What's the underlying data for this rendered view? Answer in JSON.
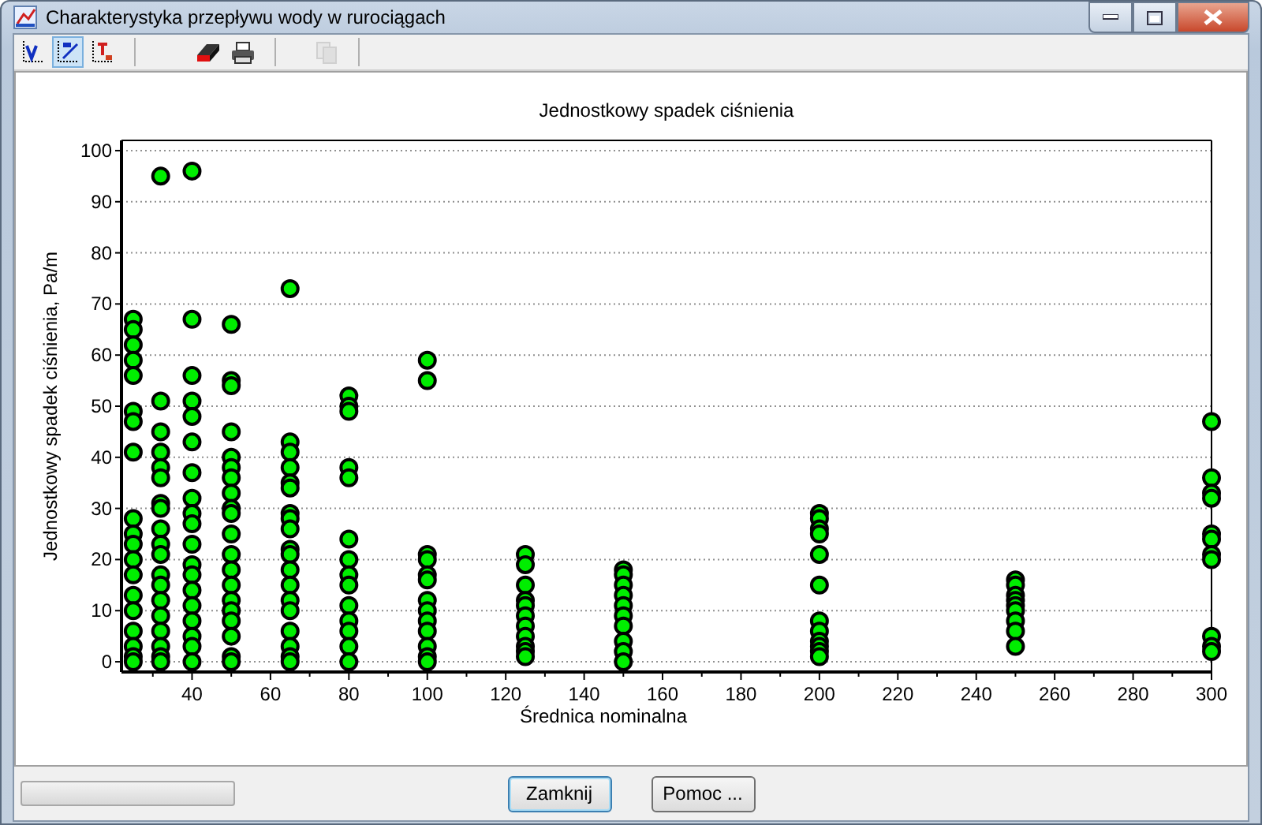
{
  "window": {
    "title": "Charakterystyka przepływu wody w rurociągach"
  },
  "toolbar": [
    {
      "kind": "chart-v",
      "selected": false,
      "disabled": false
    },
    {
      "kind": "chart-dp",
      "selected": true,
      "disabled": false
    },
    {
      "kind": "chart-t",
      "selected": false,
      "disabled": false
    },
    {
      "kind": "eraser",
      "selected": false,
      "disabled": false
    },
    {
      "kind": "printer",
      "selected": false,
      "disabled": false
    },
    {
      "kind": "copy",
      "selected": false,
      "disabled": true
    }
  ],
  "chart": {
    "chart_data": {
      "type": "scatter",
      "title": "Jednostkowy spadek ciśnienia",
      "xlabel": "Średnica nominalna",
      "ylabel": "Jednostkowy spadek ciśnienia, Pa/m",
      "xlim": [
        22,
        300
      ],
      "ylim": [
        -2,
        102
      ],
      "xticks": [
        40,
        60,
        80,
        100,
        120,
        140,
        160,
        180,
        200,
        220,
        240,
        260,
        280,
        300
      ],
      "yticks": [
        0,
        10,
        20,
        30,
        40,
        50,
        60,
        70,
        80,
        90,
        100
      ],
      "x": [
        25,
        25,
        25,
        25,
        25,
        25,
        25,
        25,
        25,
        25,
        25,
        25,
        25,
        25,
        25,
        25,
        25,
        25,
        25,
        32,
        32,
        32,
        32,
        32,
        32,
        32,
        32,
        32,
        32,
        32,
        32,
        32,
        32,
        32,
        32,
        32,
        32,
        32,
        40,
        40,
        40,
        40,
        40,
        40,
        40,
        40,
        40,
        40,
        40,
        40,
        40,
        40,
        40,
        40,
        40,
        40,
        40,
        50,
        50,
        50,
        50,
        50,
        50,
        50,
        50,
        50,
        50,
        50,
        50,
        50,
        50,
        50,
        50,
        50,
        50,
        50,
        50,
        65,
        65,
        65,
        65,
        65,
        65,
        65,
        65,
        65,
        65,
        65,
        65,
        65,
        65,
        65,
        65,
        65,
        65,
        65,
        80,
        80,
        80,
        80,
        80,
        80,
        80,
        80,
        80,
        80,
        80,
        80,
        80,
        80,
        100,
        100,
        100,
        100,
        100,
        100,
        100,
        100,
        100,
        100,
        100,
        100,
        100,
        125,
        125,
        125,
        125,
        125,
        125,
        125,
        125,
        125,
        125,
        125,
        150,
        150,
        150,
        150,
        150,
        150,
        150,
        150,
        150,
        150,
        200,
        200,
        200,
        200,
        200,
        200,
        200,
        200,
        200,
        200,
        200,
        200,
        250,
        250,
        250,
        250,
        250,
        250,
        250,
        250,
        250,
        300,
        300,
        300,
        300,
        300,
        300,
        300,
        300,
        300,
        300,
        300
      ],
      "grid": true,
      "series": [
        {
          "color": "#00ee00",
          "values": [
            67,
            65,
            62,
            59,
            56,
            49,
            47,
            41,
            28,
            25,
            23,
            20,
            17,
            13,
            10,
            6,
            3,
            1,
            0,
            95,
            51,
            45,
            41,
            38,
            36,
            31,
            30,
            26,
            23,
            21,
            17,
            15,
            12,
            9,
            6,
            3,
            1,
            0,
            96,
            67,
            56,
            51,
            48,
            43,
            37,
            32,
            29,
            27,
            23,
            19,
            17,
            14,
            11,
            8,
            5,
            3,
            0,
            66,
            55,
            54,
            45,
            40,
            38,
            36,
            33,
            30,
            29,
            25,
            21,
            18,
            15,
            12,
            10,
            8,
            5,
            1,
            0,
            73,
            43,
            41,
            38,
            35,
            34,
            29,
            28,
            26,
            22,
            21,
            18,
            15,
            12,
            10,
            6,
            3,
            1,
            0,
            52,
            50,
            49,
            38,
            36,
            24,
            20,
            17,
            15,
            11,
            8,
            6,
            3,
            0,
            59,
            55,
            21,
            20,
            17,
            16,
            12,
            10,
            8,
            6,
            3,
            1,
            0,
            21,
            19,
            15,
            12,
            11,
            9,
            7,
            5,
            3,
            2,
            1,
            18,
            17,
            15,
            13,
            11,
            9,
            7,
            4,
            2,
            0,
            29,
            28,
            26,
            25,
            21,
            15,
            8,
            6,
            4,
            3,
            2,
            1,
            16,
            15,
            13,
            12,
            11,
            10,
            8,
            6,
            3,
            47,
            36,
            33,
            32,
            25,
            24,
            21,
            20,
            5,
            3,
            2
          ]
        }
      ]
    }
  },
  "progress": {
    "level": 0
  },
  "buttons": [
    {
      "label": "Zamknij",
      "selected": true
    },
    {
      "label": "Pomoc ...",
      "selected": false
    }
  ]
}
